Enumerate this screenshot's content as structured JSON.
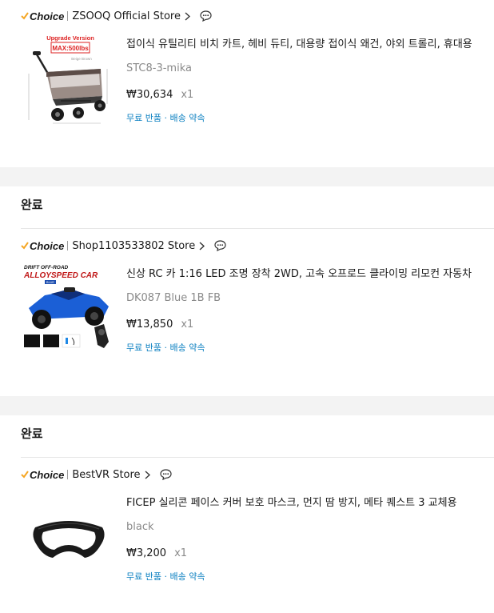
{
  "orders": [
    {
      "status": "",
      "choice_label": "Choice",
      "store": "ZSOOQ Official Store",
      "title": "접이식 유틸리티 비치 카트, 헤비 듀티, 대용량 접이식 왜건, 야외 트롤리, 휴대용",
      "sku": "STC8-3-mika",
      "price": "₩30,634",
      "qty": "x1",
      "perks": "무료 반품 · 배송 약속",
      "image": {
        "tag": "Upgrade Version",
        "badge": "MAX:500lbs",
        "caption": "Beige Brown"
      }
    },
    {
      "status": "완료",
      "choice_label": "Choice",
      "store": "Shop1103533802 Store",
      "title": "신상 RC 카 1:16 LED 조명 장착 2WD, 고속 오프로드 클라이밍 리모컨 자동차",
      "sku": "DK087 Blue 1B FB",
      "price": "₩13,850",
      "qty": "x1",
      "perks": "무료 반품 · 배송 약속",
      "image": {
        "top": "DRIFT OFF-ROAD",
        "main": "ALLOYSPEED CAR",
        "tag": "BLUE"
      }
    },
    {
      "status": "완료",
      "choice_label": "Choice",
      "store": "BestVR Store",
      "title": "FICEP 실리콘 페이스 커버 보호 마스크, 먼지 땀 방지, 메타 퀘스트 3 교체용",
      "sku": "black",
      "price": "₩3,200",
      "qty": "x1",
      "perks": "무료 반품 · 배송 약속"
    }
  ],
  "colors": {
    "checkmark": "#f5a623",
    "perks": "#0a7fc0",
    "separator": "#f3f3f3"
  },
  "icons": {
    "store_arrow": "chevron-right-icon",
    "chat": "chat-bubble-icon",
    "choice_check": "check-icon"
  }
}
